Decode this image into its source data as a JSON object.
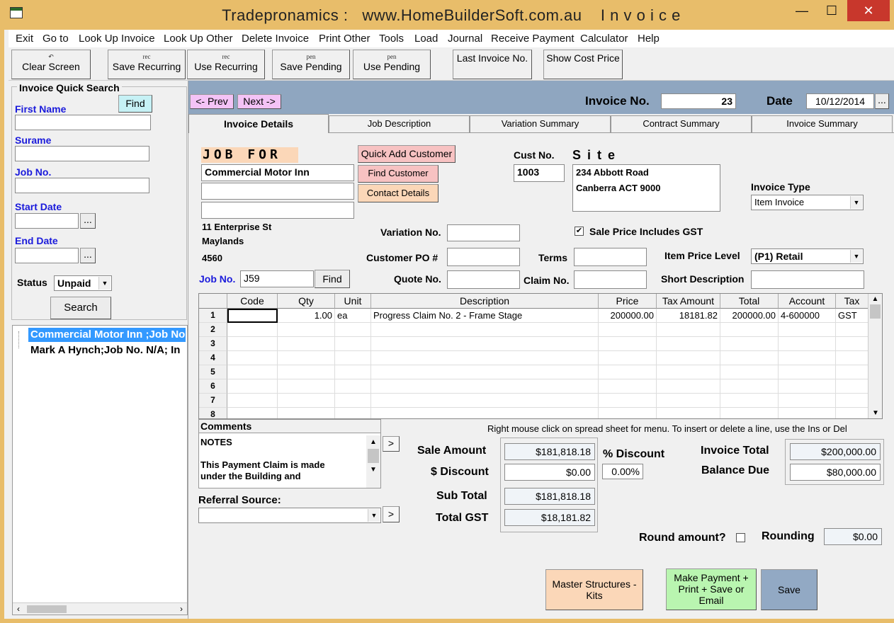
{
  "window": {
    "title": "Tradepronamics :   www.HomeBuilderSoft.com.au    I n v o i c e",
    "minimize": "—",
    "maximize": "☐",
    "close": "✕"
  },
  "menu": [
    "Exit",
    "Go to",
    "Look Up Invoice",
    "Look Up Other",
    "Delete Invoice",
    "Print Other",
    "Tools",
    "Load",
    "Journal",
    "Receive Payment",
    "Calculator",
    "Help"
  ],
  "toolbar": [
    {
      "icon": "↶",
      "label": "Clear Screen"
    },
    {
      "icon": "rec",
      "label": "Save Recurring"
    },
    {
      "icon": "rec",
      "label": "Use Recurring"
    },
    {
      "icon": "pen",
      "label": "Save Pending"
    },
    {
      "icon": "pen",
      "label": "Use Pending"
    },
    {
      "icon": "",
      "label": "Last Invoice No."
    },
    {
      "icon": "",
      "label": "Show Cost Price"
    }
  ],
  "quick_search": {
    "title": "Invoice Quick Search",
    "find": "Find",
    "first_name": "First Name",
    "surname": "Surame",
    "job_no": "Job No.",
    "start_date": "Start Date",
    "end_date": "End Date",
    "status_label": "Status",
    "status_value": "Unpaid",
    "search": "Search",
    "results": [
      "Commercial Motor Inn  ;Job No",
      "Mark A Hynch;Job No. N/A; In"
    ]
  },
  "nav": {
    "prev": "<- Prev",
    "next": "Next ->",
    "invoice_no_label": "Invoice No.",
    "invoice_no": "23",
    "date_label": "Date",
    "date": "10/12/2014",
    "ellipsis": "..."
  },
  "tabs": [
    "Invoice Details",
    "Job Description",
    "Variation Summary",
    "Contract Summary",
    "Invoice Summary"
  ],
  "job": {
    "job_for": "JOB FOR",
    "name": "Commercial Motor Inn",
    "line2": "",
    "line3": "",
    "addr1": "11 Enterprise St",
    "addr2": "Maylands",
    "addr3": "4560",
    "job_no_label": "Job No.",
    "job_no": "J59",
    "find": "Find",
    "quick_add": "Quick Add Customer",
    "find_customer": "Find Customer",
    "contact_details": "Contact Details",
    "cust_no_label": "Cust No.",
    "cust_no": "1003",
    "site_label": "S i t e",
    "site1": "234 Abbott Road",
    "site2": "Canberra ACT 9000",
    "invoice_type_label": "Invoice Type",
    "invoice_type": "Item Invoice",
    "variation_label": "Variation No.",
    "po_label": "Customer PO #",
    "terms_label": "Terms",
    "quote_label": "Quote No.",
    "claim_label": "Claim No.",
    "gst_check": "Sale Price Includes GST",
    "price_level_label": "Item Price Level",
    "price_level": "(P1) Retail",
    "short_desc_label": "Short Description"
  },
  "grid": {
    "headers": [
      "Code",
      "Qty",
      "Unit",
      "Description",
      "Price",
      "Tax Amount",
      "Total",
      "Account",
      "Tax"
    ],
    "rows": [
      {
        "n": "1",
        "code": "",
        "qty": "1.00",
        "unit": "ea",
        "desc": "Progress Claim No. 2 - Frame Stage",
        "price": "200000.00",
        "tax": "18181.82",
        "total": "200000.00",
        "account": "4-600000",
        "taxcode": "GST"
      },
      {
        "n": "2"
      },
      {
        "n": "3"
      },
      {
        "n": "4"
      },
      {
        "n": "5"
      },
      {
        "n": "6"
      },
      {
        "n": "7"
      },
      {
        "n": "8"
      }
    ]
  },
  "footer": {
    "hint": "Right mouse click on spread sheet for menu. To insert or delete a line, use the Ins or Del",
    "comments_label": "Comments",
    "comments_1": "NOTES",
    "comments_2": "This Payment Claim is made",
    "comments_3": "under the Building and",
    "referral_label": "Referral Source:",
    "arrow": ">",
    "sale_amount_label": "Sale Amount",
    "sale_amount": "$181,818.18",
    "discount_label": "$ Discount",
    "discount": "$0.00",
    "pct_discount_label": "% Discount",
    "pct_discount": "0.00%",
    "subtotal_label": "Sub Total",
    "subtotal": "$181,818.18",
    "gst_label": "Total GST",
    "gst": "$18,181.82",
    "invoice_total_label": "Invoice Total",
    "invoice_total": "$200,000.00",
    "balance_label": "Balance Due",
    "balance": "$80,000.00",
    "round_label": "Round amount?",
    "rounding_label": "Rounding",
    "rounding": "$0.00",
    "master": "Master Structures - Kits",
    "make_payment": "Make Payment + Print + Save or Email",
    "save": "Save"
  },
  "colors": {
    "frame": "#e8bd6a",
    "nav_bar": "#8fa6c0",
    "link_blue": "#1a1adb",
    "pink": "#f7c2c2",
    "peach": "#fbd7b8",
    "green": "#b9f5b0",
    "save_blue": "#92a9c4"
  }
}
